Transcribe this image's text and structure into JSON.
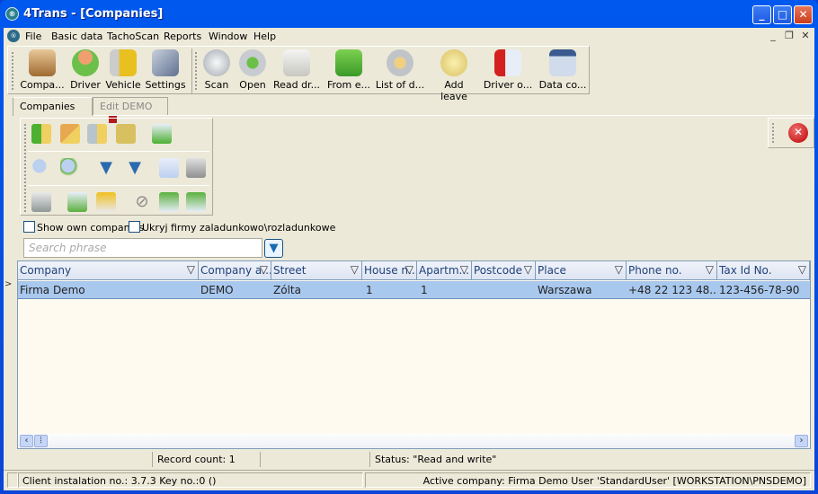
{
  "window": {
    "title": "4Trans - [Companies]",
    "app_icon": "app-logo-icon"
  },
  "menubar": {
    "items": [
      "File",
      "Basic data",
      "TachoScan",
      "Reports",
      "Window",
      "Help"
    ]
  },
  "toolbar": {
    "group1": [
      {
        "label": "Compa...",
        "icon": "companies-icon"
      },
      {
        "label": "Driver",
        "icon": "driver-icon"
      },
      {
        "label": "Vehicle",
        "icon": "vehicle-icon"
      },
      {
        "label": "Settings",
        "icon": "settings-icon"
      }
    ],
    "group2": [
      {
        "label": "Scan",
        "icon": "scan-icon"
      },
      {
        "label": "Open",
        "icon": "open-icon"
      },
      {
        "label": "Read dr...",
        "icon": "read-driver-card-icon"
      },
      {
        "label": "From e...",
        "icon": "from-external-icon"
      },
      {
        "label": "List of d...",
        "icon": "list-of-data-icon"
      },
      {
        "label": "Add leave",
        "icon": "add-leave-icon"
      },
      {
        "label": "Driver o...",
        "icon": "driver-offences-icon"
      },
      {
        "label": "Data co...",
        "icon": "data-copy-icon"
      }
    ]
  },
  "tabs": [
    {
      "label": "Companies",
      "active": true
    },
    {
      "label": "Edit DEMO",
      "active": false
    }
  ],
  "filters": {
    "show_own": "Show own companies",
    "hide_loading": "Ukryj firmy zaladunkowo\\rozladunkowe",
    "search_placeholder": "Search phrase"
  },
  "grid": {
    "columns": [
      "Company",
      "Company a...",
      "Street",
      "House n...",
      "Apartm...",
      "Postcode",
      "Place",
      "Phone no.",
      "Tax Id No."
    ],
    "rows": [
      [
        "Firma Demo",
        "DEMO",
        "Zólta",
        "1",
        "1",
        "",
        "Warszawa",
        "+48 22 123 48...",
        "123-456-78-90"
      ]
    ]
  },
  "status": {
    "record_count": "Record count: 1",
    "access": "Status: \"Read and write\"",
    "client": "Client instalation no.: 3.7.3   Key no.:0 ()",
    "active": "Active company: Firma Demo   User 'StandardUser'   [WORKSTATION\\PNSDEMO]"
  }
}
